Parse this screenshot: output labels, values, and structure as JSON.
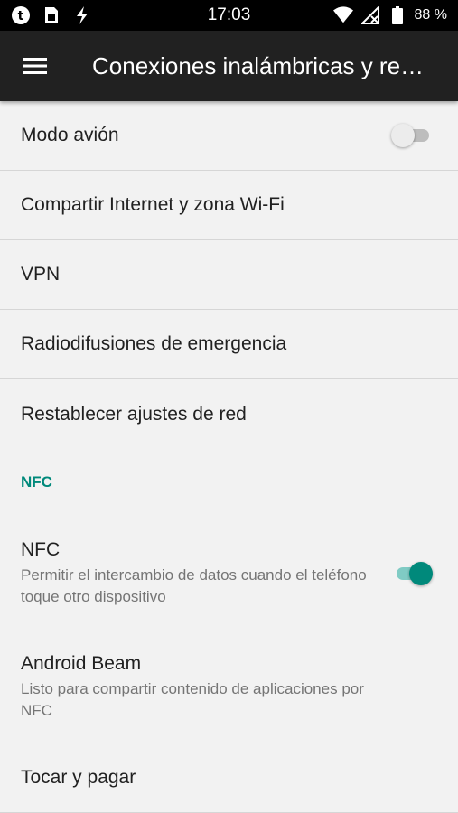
{
  "status_bar": {
    "time": "17:03",
    "battery": "88 %",
    "left_icons": [
      "t-notification-icon",
      "sim-card-icon",
      "flash-icon"
    ],
    "right_icons": [
      "wifi-icon",
      "no-signal-icon",
      "battery-icon"
    ]
  },
  "app_bar": {
    "title": "Conexiones inalámbricas y re…",
    "menu_icon": "menu-icon"
  },
  "items": [
    {
      "title": "Modo avión",
      "toggle": false
    },
    {
      "title": "Compartir Internet y zona Wi-Fi"
    },
    {
      "title": "VPN"
    },
    {
      "title": "Radiodifusiones de emergencia"
    },
    {
      "title": "Restablecer ajustes de red"
    }
  ],
  "nfc_section": {
    "header": "NFC",
    "items": [
      {
        "title": "NFC",
        "subtitle": "Permitir el intercambio de datos cuando el teléfono toque otro dispositivo",
        "toggle": true
      },
      {
        "title": "Android Beam",
        "subtitle": "Listo para compartir contenido de aplicaciones por NFC"
      },
      {
        "title": "Tocar y pagar"
      }
    ]
  },
  "colors": {
    "accent": "#00897b",
    "app_bar": "#212121",
    "background": "#f2f2f2"
  }
}
